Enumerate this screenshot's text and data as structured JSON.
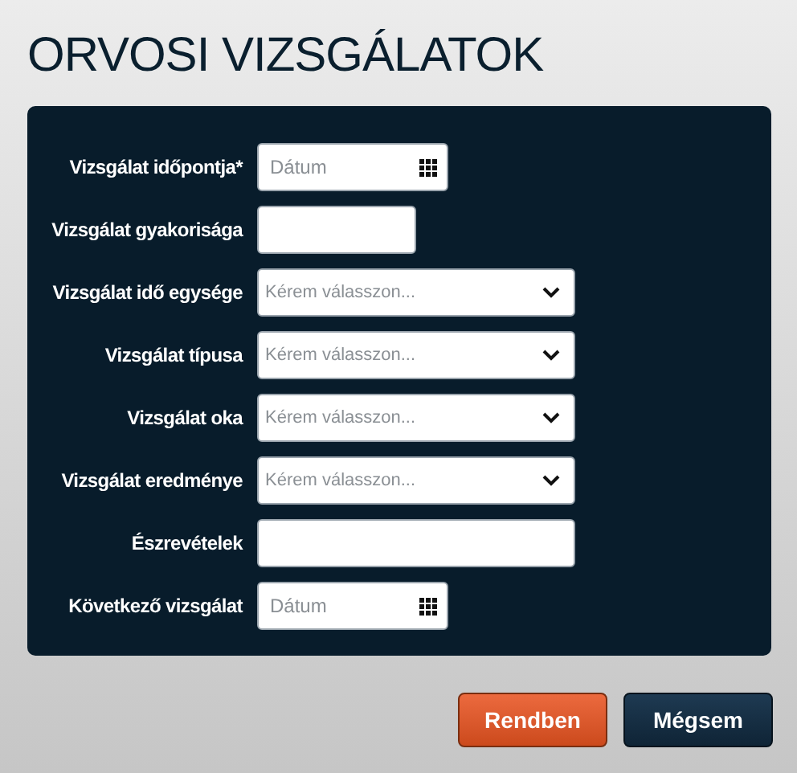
{
  "title": "ORVOSI VIZSGÁLATOK",
  "fields": [
    {
      "label": "Vizsgálat időpontja*",
      "kind": "date",
      "placeholder": "Dátum"
    },
    {
      "label": "Vizsgálat gyakorisága",
      "kind": "short"
    },
    {
      "label": "Vizsgálat idő egysége",
      "kind": "select",
      "placeholder": "Kérem válasszon..."
    },
    {
      "label": "Vizsgálat típusa",
      "kind": "select",
      "placeholder": "Kérem válasszon..."
    },
    {
      "label": "Vizsgálat oka",
      "kind": "select",
      "placeholder": "Kérem válasszon..."
    },
    {
      "label": "Vizsgálat eredménye",
      "kind": "select",
      "placeholder": "Kérem válasszon..."
    },
    {
      "label": "Észrevételek",
      "kind": "wide"
    },
    {
      "label": "Következő vizsgálat",
      "kind": "date",
      "placeholder": "Dátum"
    }
  ],
  "buttons": [
    {
      "label": "Rendben",
      "kind": "primary"
    },
    {
      "label": "Mégsem",
      "kind": "secondary"
    }
  ]
}
